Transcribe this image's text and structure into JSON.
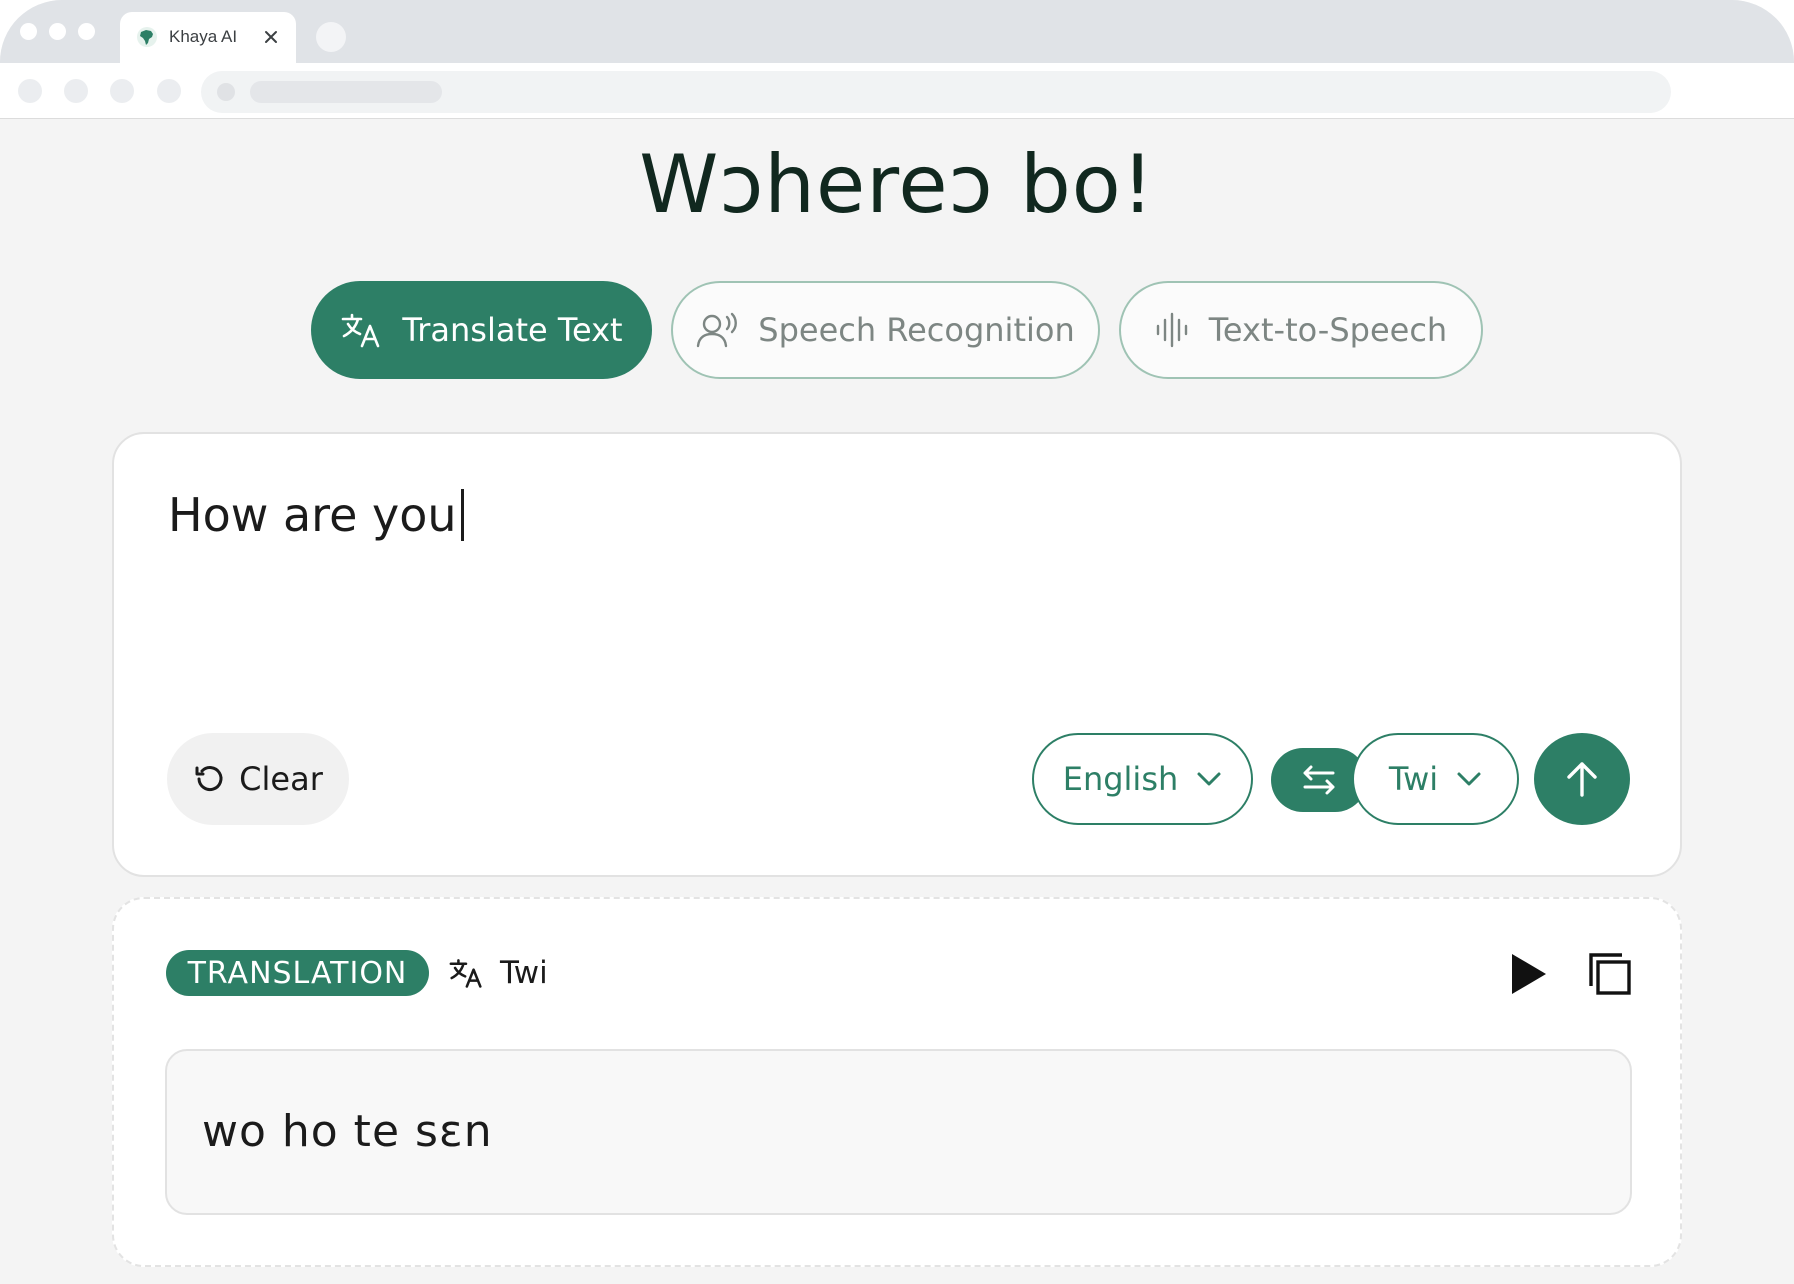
{
  "browser": {
    "tab_title": "Khaya AI",
    "tab_icon": "africa-globe-icon"
  },
  "page": {
    "title": "Wɔhereɔ bo!"
  },
  "modes": [
    {
      "label": "Translate Text",
      "icon": "translate-icon",
      "active": true
    },
    {
      "label": "Speech Recognition",
      "icon": "voice-icon",
      "active": false
    },
    {
      "label": "Text-to-Speech",
      "icon": "waveform-icon",
      "active": false
    }
  ],
  "input": {
    "text": "How are you",
    "clear_label": "Clear",
    "source_language": "English",
    "target_language": "Twi"
  },
  "result": {
    "badge": "TRANSLATION",
    "language": "Twi",
    "text": "wo ho te sɛn"
  },
  "colors": {
    "accent": "#2d7f66",
    "background": "#f4f4f4",
    "title": "#11281f"
  }
}
